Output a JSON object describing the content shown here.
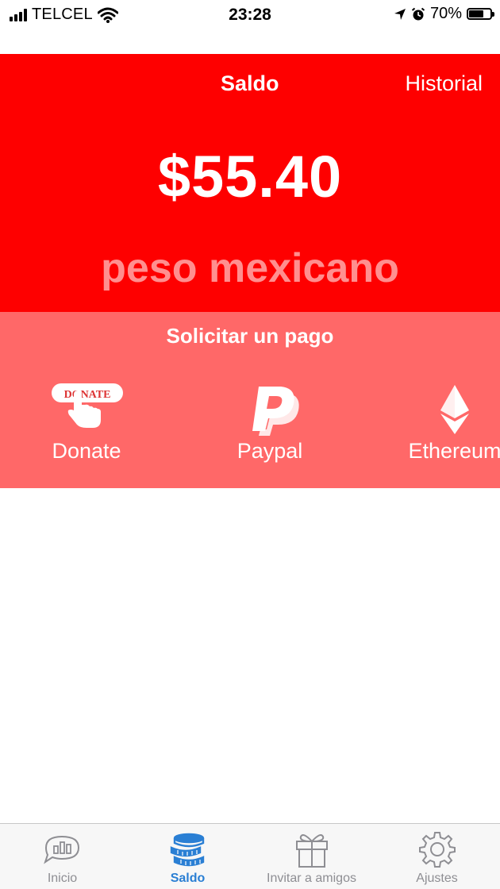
{
  "status_bar": {
    "carrier": "TELCEL",
    "time": "23:28",
    "battery_percent": "70%",
    "battery_level": 0.7,
    "icons": [
      "signal-icon",
      "wifi-icon",
      "location-arrow-icon",
      "alarm-icon",
      "battery-icon"
    ]
  },
  "header": {
    "tabs": [
      {
        "label": "Saldo",
        "active": true
      },
      {
        "label": "Historial",
        "active": false
      }
    ]
  },
  "balance": {
    "amount": "$55.40",
    "currency": "peso mexicano"
  },
  "payment": {
    "title": "Solicitar un pago",
    "methods": [
      {
        "label": "Donate",
        "icon": "donate-button-icon",
        "icon_text": "DONATE"
      },
      {
        "label": "Paypal",
        "icon": "paypal-icon"
      },
      {
        "label": "Ethereum",
        "icon": "ethereum-icon"
      }
    ]
  },
  "tab_bar": {
    "items": [
      {
        "label": "Inicio",
        "icon": "chat-chart-icon",
        "active": false
      },
      {
        "label": "Saldo",
        "icon": "coins-icon",
        "active": true
      },
      {
        "label": "Invitar a amigos",
        "icon": "gift-icon",
        "active": false
      },
      {
        "label": "Ajustes",
        "icon": "gear-icon",
        "active": false
      }
    ]
  },
  "colors": {
    "primary_red": "#fe0000",
    "panel_pink": "#ff6868",
    "currency_text": "#ff8f8f",
    "tab_active": "#2a7fd4",
    "tab_inactive": "#8e8e93"
  }
}
